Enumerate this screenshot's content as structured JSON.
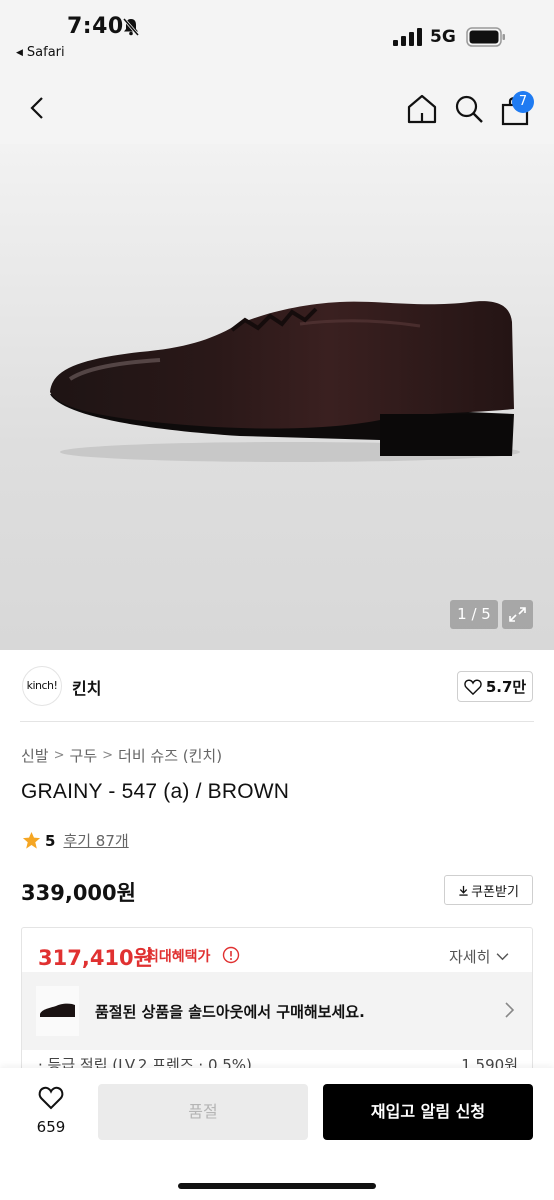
{
  "status_bar": {
    "time": "7:40",
    "back_app": "Safari",
    "network": "5G",
    "icons": [
      "bell-slash-icon",
      "signal-icon",
      "battery-icon"
    ]
  },
  "nav": {
    "icons": [
      "back-chevron-icon",
      "home-icon",
      "search-icon",
      "shopping-bag-icon"
    ],
    "cart_count": "7"
  },
  "gallery": {
    "counter": "1 / 5",
    "expand_icon": "expand-icon"
  },
  "brand": {
    "logo_text": "kinch!",
    "name": "킨치",
    "like_count": "5.7만"
  },
  "product": {
    "breadcrumb": [
      "신발",
      "구두",
      "더비 슈즈 (킨치)"
    ],
    "title": "GRAINY - 547 (a) / BROWN",
    "rating": "5",
    "reviews": "후기 87개",
    "price": "339,000원",
    "coupon_label": "쿠폰받기"
  },
  "benefit": {
    "max_price": "317,410원",
    "max_label": "최대혜택가",
    "detail_label": "자세히",
    "soldout_message": "품절된 상품을 솔드아웃에서 구매해보세요.",
    "points_label": "· 등급 적립 (LV.2 프렌즈 · 0.5%)",
    "points_value": "1,590원"
  },
  "bottom": {
    "wish_count": "659",
    "soldout_label": "품절",
    "restock_label": "재입고 알림 신청"
  },
  "colors": {
    "accent_red": "#e03131",
    "badge_blue": "#1f7bf2",
    "primary_button": "#000000"
  }
}
